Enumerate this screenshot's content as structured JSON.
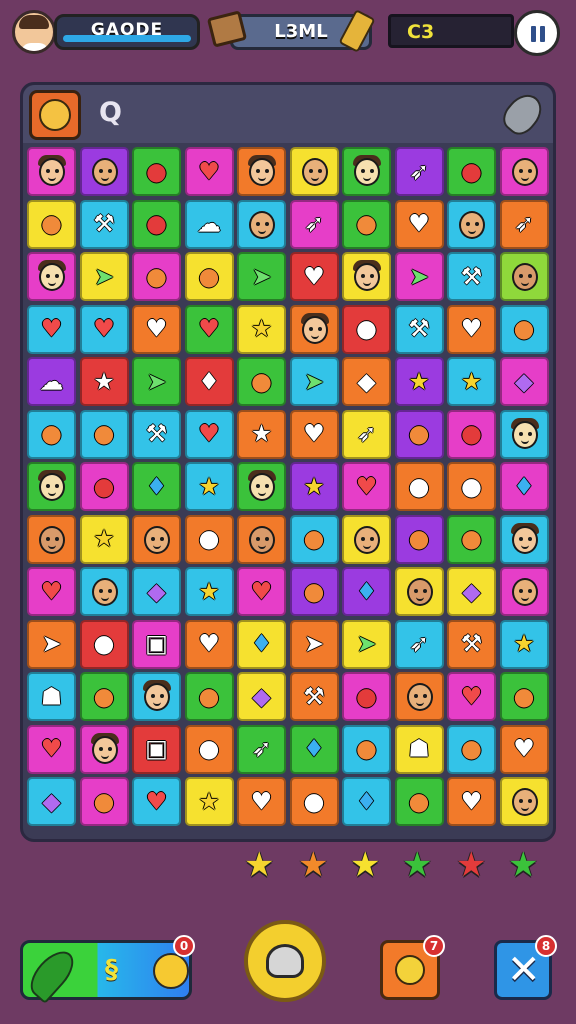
{
  "hud": {
    "player_name": "GAODE",
    "level_label": "L3ML",
    "score": "C3",
    "avatar_icon": "player-avatar",
    "chest_icon": "treasure-chest-icon",
    "tool_icon": "hammer-icon",
    "pause_icon": "pause-icon"
  },
  "board_toolbar": {
    "left_icon": "coin-icon",
    "search_glyph": "Q",
    "right_icon": "shovel-icon"
  },
  "palette": {
    "magenta": "#e63ec8",
    "purple": "#9b3be0",
    "green": "#3bc23b",
    "yellow": "#f6e12f",
    "orange": "#f27a2a",
    "red": "#e33b3b",
    "cyan": "#33c3e8",
    "blue": "#3b8ef0",
    "lime": "#8fd83b"
  },
  "grid": {
    "rows": [
      [
        {
          "c": "magenta",
          "s": "face"
        },
        {
          "c": "purple",
          "s": "face"
        },
        {
          "c": "green",
          "s": "apple"
        },
        {
          "c": "magenta",
          "s": "heart"
        },
        {
          "c": "orange",
          "s": "face"
        },
        {
          "c": "yellow",
          "s": "face"
        },
        {
          "c": "green",
          "s": "face"
        },
        {
          "c": "purple",
          "s": "sword"
        },
        {
          "c": "green",
          "s": "apple"
        },
        {
          "c": "magenta",
          "s": "face"
        }
      ],
      [
        {
          "c": "yellow",
          "s": "blob"
        },
        {
          "c": "cyan",
          "s": "axe"
        },
        {
          "c": "green",
          "s": "apple"
        },
        {
          "c": "cyan",
          "s": "cloud"
        },
        {
          "c": "cyan",
          "s": "face"
        },
        {
          "c": "magenta",
          "s": "sword"
        },
        {
          "c": "green",
          "s": "blob"
        },
        {
          "c": "orange",
          "s": "heart"
        },
        {
          "c": "cyan",
          "s": "face"
        },
        {
          "c": "orange",
          "s": "sword"
        }
      ],
      [
        {
          "c": "magenta",
          "s": "face"
        },
        {
          "c": "yellow",
          "s": "leaf"
        },
        {
          "c": "magenta",
          "s": "blob"
        },
        {
          "c": "yellow",
          "s": "blob"
        },
        {
          "c": "green",
          "s": "leaf"
        },
        {
          "c": "red",
          "s": "heart"
        },
        {
          "c": "yellow",
          "s": "face"
        },
        {
          "c": "magenta",
          "s": "leaf"
        },
        {
          "c": "cyan",
          "s": "axe"
        },
        {
          "c": "lime",
          "s": "face"
        }
      ],
      [
        {
          "c": "cyan",
          "s": "heart"
        },
        {
          "c": "cyan",
          "s": "heart"
        },
        {
          "c": "orange",
          "s": "heart"
        },
        {
          "c": "green",
          "s": "heart"
        },
        {
          "c": "yellow",
          "s": "star"
        },
        {
          "c": "orange",
          "s": "face"
        },
        {
          "c": "red",
          "s": "apple"
        },
        {
          "c": "cyan",
          "s": "axe"
        },
        {
          "c": "orange",
          "s": "heart"
        },
        {
          "c": "cyan",
          "s": "blob"
        }
      ],
      [
        {
          "c": "purple",
          "s": "cloud"
        },
        {
          "c": "red",
          "s": "star"
        },
        {
          "c": "green",
          "s": "leaf"
        },
        {
          "c": "red",
          "s": "drop"
        },
        {
          "c": "green",
          "s": "blob"
        },
        {
          "c": "cyan",
          "s": "leaf"
        },
        {
          "c": "orange",
          "s": "gem"
        },
        {
          "c": "purple",
          "s": "star"
        },
        {
          "c": "cyan",
          "s": "star"
        },
        {
          "c": "magenta",
          "s": "gem"
        }
      ],
      [
        {
          "c": "cyan",
          "s": "blob"
        },
        {
          "c": "cyan",
          "s": "blob"
        },
        {
          "c": "cyan",
          "s": "axe"
        },
        {
          "c": "cyan",
          "s": "heart"
        },
        {
          "c": "orange",
          "s": "star"
        },
        {
          "c": "orange",
          "s": "heart"
        },
        {
          "c": "yellow",
          "s": "sword"
        },
        {
          "c": "purple",
          "s": "blob"
        },
        {
          "c": "magenta",
          "s": "apple"
        },
        {
          "c": "cyan",
          "s": "face"
        }
      ],
      [
        {
          "c": "green",
          "s": "face"
        },
        {
          "c": "magenta",
          "s": "apple"
        },
        {
          "c": "green",
          "s": "drop"
        },
        {
          "c": "cyan",
          "s": "star"
        },
        {
          "c": "green",
          "s": "face"
        },
        {
          "c": "purple",
          "s": "star"
        },
        {
          "c": "magenta",
          "s": "heart"
        },
        {
          "c": "orange",
          "s": "blob"
        },
        {
          "c": "orange",
          "s": "blob"
        },
        {
          "c": "magenta",
          "s": "drop"
        }
      ],
      [
        {
          "c": "orange",
          "s": "face"
        },
        {
          "c": "yellow",
          "s": "star"
        },
        {
          "c": "orange",
          "s": "face"
        },
        {
          "c": "orange",
          "s": "blob"
        },
        {
          "c": "orange",
          "s": "face"
        },
        {
          "c": "cyan",
          "s": "blob"
        },
        {
          "c": "yellow",
          "s": "face"
        },
        {
          "c": "purple",
          "s": "blob"
        },
        {
          "c": "green",
          "s": "blob"
        },
        {
          "c": "cyan",
          "s": "face"
        }
      ],
      [
        {
          "c": "magenta",
          "s": "heart"
        },
        {
          "c": "cyan",
          "s": "face"
        },
        {
          "c": "cyan",
          "s": "gem"
        },
        {
          "c": "cyan",
          "s": "star"
        },
        {
          "c": "magenta",
          "s": "heart"
        },
        {
          "c": "purple",
          "s": "blob"
        },
        {
          "c": "purple",
          "s": "drop"
        },
        {
          "c": "yellow",
          "s": "face"
        },
        {
          "c": "yellow",
          "s": "gem"
        },
        {
          "c": "magenta",
          "s": "face"
        }
      ],
      [
        {
          "c": "orange",
          "s": "leaf"
        },
        {
          "c": "red",
          "s": "blob"
        },
        {
          "c": "magenta",
          "s": "box"
        },
        {
          "c": "orange",
          "s": "heart"
        },
        {
          "c": "yellow",
          "s": "drop"
        },
        {
          "c": "orange",
          "s": "leaf"
        },
        {
          "c": "yellow",
          "s": "leaf"
        },
        {
          "c": "cyan",
          "s": "sword"
        },
        {
          "c": "orange",
          "s": "axe"
        },
        {
          "c": "cyan",
          "s": "star"
        }
      ],
      [
        {
          "c": "cyan",
          "s": "ghost"
        },
        {
          "c": "green",
          "s": "blob"
        },
        {
          "c": "cyan",
          "s": "face"
        },
        {
          "c": "green",
          "s": "blob"
        },
        {
          "c": "yellow",
          "s": "gem"
        },
        {
          "c": "orange",
          "s": "axe"
        },
        {
          "c": "magenta",
          "s": "apple"
        },
        {
          "c": "orange",
          "s": "face"
        },
        {
          "c": "magenta",
          "s": "heart"
        },
        {
          "c": "green",
          "s": "blob"
        }
      ],
      [
        {
          "c": "magenta",
          "s": "heart"
        },
        {
          "c": "magenta",
          "s": "face"
        },
        {
          "c": "red",
          "s": "box"
        },
        {
          "c": "orange",
          "s": "apple"
        },
        {
          "c": "green",
          "s": "sword"
        },
        {
          "c": "green",
          "s": "drop"
        },
        {
          "c": "cyan",
          "s": "blob"
        },
        {
          "c": "yellow",
          "s": "ghost"
        },
        {
          "c": "cyan",
          "s": "blob"
        },
        {
          "c": "orange",
          "s": "heart"
        }
      ],
      [
        {
          "c": "cyan",
          "s": "gem"
        },
        {
          "c": "magenta",
          "s": "blob"
        },
        {
          "c": "cyan",
          "s": "heart"
        },
        {
          "c": "yellow",
          "s": "star"
        },
        {
          "c": "orange",
          "s": "heart"
        },
        {
          "c": "orange",
          "s": "blob"
        },
        {
          "c": "cyan",
          "s": "drop"
        },
        {
          "c": "green",
          "s": "blob"
        },
        {
          "c": "orange",
          "s": "heart"
        },
        {
          "c": "yellow",
          "s": "face"
        }
      ]
    ]
  },
  "goal_stars": [
    {
      "color": "#f6d42f"
    },
    {
      "color": "#f28a2a"
    },
    {
      "color": "#f6e12f"
    },
    {
      "color": "#3bc23b"
    },
    {
      "color": "#e33b3b"
    },
    {
      "color": "#3bc23b"
    }
  ],
  "bottom_bar": {
    "left_booster_icon": "leaf-booster-icon",
    "left_booster_glyph": "§",
    "left_badge": "0",
    "center_icon": "helmet-icon",
    "bomb_badge": "7",
    "shuffle_badge": "8"
  }
}
